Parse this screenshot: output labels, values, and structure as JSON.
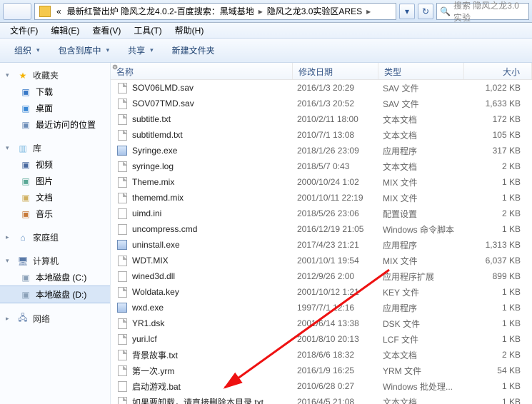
{
  "address": {
    "prefix": "«",
    "segments": [
      "最新红警出炉 隐风之龙4.0.2-百度搜索：黑域基地",
      "隐风之龙3.0实验区ARES"
    ],
    "dropdown_hint": "▾"
  },
  "search": {
    "placeholder": "搜索 隐风之龙3.0实验"
  },
  "menu": {
    "file": "文件(F)",
    "edit": "编辑(E)",
    "view": "查看(V)",
    "tools": "工具(T)",
    "help": "帮助(H)"
  },
  "toolbar": {
    "organize": "组织",
    "include": "包含到库中",
    "share": "共享",
    "newfolder": "新建文件夹"
  },
  "nav": {
    "favorites": {
      "label": "收藏夹",
      "items": [
        {
          "label": "下载",
          "icon": "i-dl"
        },
        {
          "label": "桌面",
          "icon": "i-desk"
        },
        {
          "label": "最近访问的位置",
          "icon": "i-recent"
        }
      ]
    },
    "libraries": {
      "label": "库",
      "items": [
        {
          "label": "视频",
          "icon": "i-vid"
        },
        {
          "label": "图片",
          "icon": "i-pic"
        },
        {
          "label": "文档",
          "icon": "i-doc"
        },
        {
          "label": "音乐",
          "icon": "i-mus"
        }
      ]
    },
    "homegroup": {
      "label": "家庭组"
    },
    "computer": {
      "label": "计算机",
      "items": [
        {
          "label": "本地磁盘 (C:)",
          "icon": "i-drv"
        },
        {
          "label": "本地磁盘 (D:)",
          "icon": "i-drv",
          "selected": true
        }
      ]
    },
    "network": {
      "label": "网络"
    }
  },
  "columns": {
    "name": "名称",
    "date": "修改日期",
    "type": "类型",
    "size": "大小"
  },
  "files": [
    {
      "name": "SOV06LMD.sav",
      "date": "2016/1/3 20:29",
      "type": "SAV 文件",
      "size": "1,022 KB",
      "icon": "i-file"
    },
    {
      "name": "SOV07TMD.sav",
      "date": "2016/1/3 20:52",
      "type": "SAV 文件",
      "size": "1,633 KB",
      "icon": "i-file"
    },
    {
      "name": "subtitle.txt",
      "date": "2010/2/11 18:00",
      "type": "文本文档",
      "size": "172 KB",
      "icon": "i-file"
    },
    {
      "name": "subtitlemd.txt",
      "date": "2010/7/1 13:08",
      "type": "文本文档",
      "size": "105 KB",
      "icon": "i-file"
    },
    {
      "name": "Syringe.exe",
      "date": "2018/1/26 23:09",
      "type": "应用程序",
      "size": "317 KB",
      "icon": "i-exe"
    },
    {
      "name": "syringe.log",
      "date": "2018/5/7 0:43",
      "type": "文本文档",
      "size": "2 KB",
      "icon": "i-file"
    },
    {
      "name": "Theme.mix",
      "date": "2000/10/24 1:02",
      "type": "MIX 文件",
      "size": "1 KB",
      "icon": "i-file"
    },
    {
      "name": "thememd.mix",
      "date": "2001/10/11 22:19",
      "type": "MIX 文件",
      "size": "1 KB",
      "icon": "i-file"
    },
    {
      "name": "uimd.ini",
      "date": "2018/5/26 23:06",
      "type": "配置设置",
      "size": "2 KB",
      "icon": "i-ini"
    },
    {
      "name": "uncompress.cmd",
      "date": "2016/12/19 21:05",
      "type": "Windows 命令脚本",
      "size": "1 KB",
      "icon": "i-ini"
    },
    {
      "name": "uninstall.exe",
      "date": "2017/4/23 21:21",
      "type": "应用程序",
      "size": "1,313 KB",
      "icon": "i-exe"
    },
    {
      "name": "WDT.MIX",
      "date": "2001/10/1 19:54",
      "type": "MIX 文件",
      "size": "6,037 KB",
      "icon": "i-file"
    },
    {
      "name": "wined3d.dll",
      "date": "2012/9/26 2:00",
      "type": "应用程序扩展",
      "size": "899 KB",
      "icon": "i-ini"
    },
    {
      "name": "Woldata.key",
      "date": "2001/10/12 1:21",
      "type": "KEY 文件",
      "size": "1 KB",
      "icon": "i-file"
    },
    {
      "name": "wxd.exe",
      "date": "1997/7/1 12:16",
      "type": "应用程序",
      "size": "1 KB",
      "icon": "i-exe"
    },
    {
      "name": "YR1.dsk",
      "date": "2001/6/14 13:38",
      "type": "DSK 文件",
      "size": "1 KB",
      "icon": "i-file"
    },
    {
      "name": "yuri.lcf",
      "date": "2001/8/10 20:13",
      "type": "LCF 文件",
      "size": "1 KB",
      "icon": "i-file"
    },
    {
      "name": "背景故事.txt",
      "date": "2018/6/6 18:32",
      "type": "文本文档",
      "size": "2 KB",
      "icon": "i-file"
    },
    {
      "name": "第一次.yrm",
      "date": "2016/1/9 16:25",
      "type": "YRM 文件",
      "size": "54 KB",
      "icon": "i-file"
    },
    {
      "name": "启动游戏.bat",
      "date": "2010/6/28 0:27",
      "type": "Windows 批处理...",
      "size": "1 KB",
      "icon": "i-ini"
    },
    {
      "name": "如果要卸载，请直接删除本目录.txt",
      "date": "2016/4/5 21:08",
      "type": "文本文档",
      "size": "1 KB",
      "icon": "i-file"
    }
  ]
}
